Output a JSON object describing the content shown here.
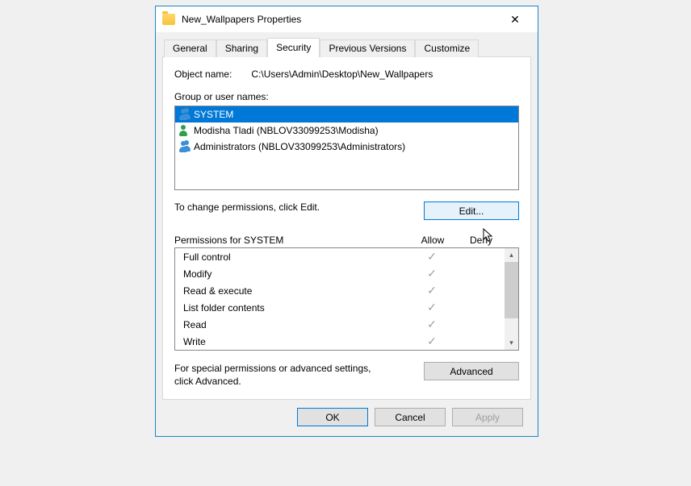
{
  "window": {
    "title": "New_Wallpapers Properties"
  },
  "tabs": {
    "general": "General",
    "sharing": "Sharing",
    "security": "Security",
    "previous": "Previous Versions",
    "customize": "Customize"
  },
  "object": {
    "label": "Object name:",
    "value": "C:\\Users\\Admin\\Desktop\\New_Wallpapers"
  },
  "groups": {
    "label": "Group or user names:",
    "items": [
      {
        "name": "SYSTEM",
        "type": "group",
        "selected": true
      },
      {
        "name": "Modisha Tladi (NBLOV33099253\\Modisha)",
        "type": "user",
        "selected": false
      },
      {
        "name": "Administrators (NBLOV33099253\\Administrators)",
        "type": "group",
        "selected": false
      }
    ]
  },
  "edit": {
    "hint": "To change permissions, click Edit.",
    "button": "Edit..."
  },
  "permissions": {
    "header_label": "Permissions for SYSTEM",
    "col_allow": "Allow",
    "col_deny": "Deny",
    "rows": [
      {
        "name": "Full control",
        "allow": true,
        "deny": false
      },
      {
        "name": "Modify",
        "allow": true,
        "deny": false
      },
      {
        "name": "Read & execute",
        "allow": true,
        "deny": false
      },
      {
        "name": "List folder contents",
        "allow": true,
        "deny": false
      },
      {
        "name": "Read",
        "allow": true,
        "deny": false
      },
      {
        "name": "Write",
        "allow": true,
        "deny": false
      }
    ]
  },
  "advanced": {
    "text": "For special permissions or advanced settings, click Advanced.",
    "button": "Advanced"
  },
  "footer": {
    "ok": "OK",
    "cancel": "Cancel",
    "apply": "Apply"
  },
  "check_glyph": "✓"
}
